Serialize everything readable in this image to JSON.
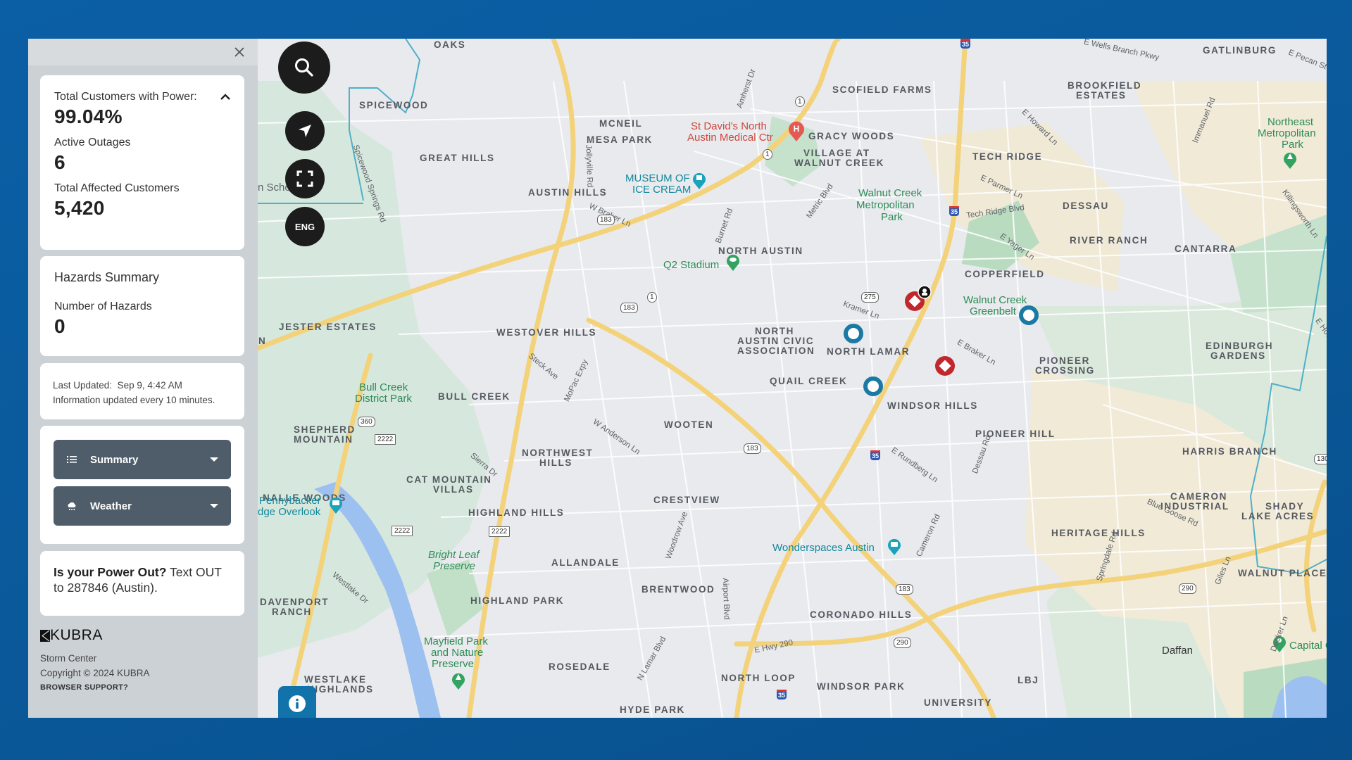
{
  "panel": {
    "close_label": "×",
    "stats": {
      "customers_with_power_label": "Total Customers with Power:",
      "customers_with_power_value": "99.04%",
      "active_outages_label": "Active Outages",
      "active_outages_value": "6",
      "affected_customers_label": "Total Affected Customers",
      "affected_customers_value": "5,420"
    },
    "hazards": {
      "title": "Hazards Summary",
      "count_label": "Number of Hazards",
      "count_value": "0"
    },
    "update": {
      "last_updated": "Last Updated:  Sep 9, 4:42 AM",
      "frequency": "Information updated every 10 minutes."
    },
    "accordions": [
      {
        "label": "Summary",
        "icon": "list-icon"
      },
      {
        "label": "Weather",
        "icon": "weather-icon"
      }
    ],
    "power_out": {
      "question": "Is your Power Out?",
      "instruction": " Text OUT to 287846 (Austin)."
    },
    "footer": {
      "logo": "KUBRA",
      "product": "Storm Center",
      "copyright": "Copyright © 2024 KUBRA",
      "browser_support": "BROWSER SUPPORT?"
    }
  },
  "map_controls": {
    "search_icon": "search-icon",
    "locate_icon": "navigation-arrow-icon",
    "fullscreen_icon": "fullscreen-icon",
    "language_label": "ENG",
    "info_icon": "info-icon"
  },
  "markers": {
    "outage_colors": {
      "crew_assigned": "#c0282d",
      "reported": "#1a7aa3"
    },
    "items": [
      {
        "type": "crew-outage",
        "badge": "crew-icon"
      },
      {
        "type": "crew-outage"
      },
      {
        "type": "outage"
      },
      {
        "type": "outage"
      },
      {
        "type": "outage"
      }
    ]
  },
  "map_labels": {
    "neighborhoods": [
      "OAKS",
      "SPICEWOOD",
      "GREAT HILLS",
      "AUSTIN HILLS",
      "MCNEIL",
      "MESA PARK",
      "SCOFIELD FARMS",
      "GRACY WOODS",
      "VILLAGE AT",
      "WALNUT CREEK",
      "TECH RIDGE",
      "GATLINBURG",
      "BROOKFIELD",
      "ESTATES",
      "DESSAU",
      "RIVER RANCH",
      "CANTARRA",
      "COPPERFIELD",
      "NORTH AUSTIN",
      "NORTH",
      "AUSTIN CIVIC",
      "ASSOCIATION",
      "NORTH LAMAR",
      "QUAIL CREEK",
      "WINDSOR HILLS",
      "PIONEER",
      "CROSSING",
      "EDINBURGH",
      "GARDENS",
      "PIONEER HILL",
      "HARRIS BRANCH",
      "SHADY",
      "LAKE ACRES",
      "JESTER ESTATES",
      "WESTOVER HILLS",
      "BULL CREEK",
      "SHEPHERD",
      "MOUNTAIN",
      "NORTHWEST",
      "HILLS",
      "WOOTEN",
      "CAT MOUNTAIN",
      "VILLAS",
      "NALLE WOODS",
      "HIGHLAND HILLS",
      "CRESTVIEW",
      "CAMERON",
      "INDUSTRIAL",
      "HERITAGE HILLS",
      "WALNUT PLACE",
      "ALLANDALE",
      "BRENTWOOD",
      "DAVENPORT",
      "RANCH",
      "HIGHLAND PARK",
      "CORONADO HILLS",
      "WESTLAKE",
      "HIGHLANDS",
      "ROSEDALE",
      "NORTH LOOP",
      "WINDSOR PARK",
      "LBJ",
      "UNIVERSITY",
      "HYDE PARK",
      "N"
    ],
    "parks": [
      "Walnut Creek",
      "Metropolitan",
      "Park",
      "Walnut Creek",
      "Greenbelt",
      "Northeast",
      "Metropolitan",
      "Park",
      "Bull Creek",
      "District Park",
      "Bright Leaf",
      "Preserve",
      "Mayfield Park",
      "and Nature",
      "Preserve",
      "Capital Cit"
    ],
    "pois": [
      "St David's North",
      "Austin Medical Ctr",
      "MUSEUM OF",
      "ICE CREAM",
      "Q2 Stadium",
      "Pennybacker",
      "dge Overlook",
      "Wonderspaces Austin",
      "n Scho"
    ],
    "streets": [
      "E Wells Branch Pkwy",
      "E Pecan St",
      "Immanuel Rd",
      "E Howard Ln",
      "Killingsworth Ln",
      "E Parmer Ln",
      "Tech Ridge Blvd",
      "E Yager Ln",
      "Metric Blvd",
      "Burnet Rd",
      "Amherst Dr",
      "W Braker Ln",
      "Jollyville Rd",
      "Spicewood Springs Rd",
      "Kramer Ln",
      "E Braker Ln",
      "Dessau Rd",
      "E Rundberg Ln",
      "Cameron Rd",
      "Springdale Rd",
      "Blue Goose Rd",
      "Giles Ln",
      "Decker Ln",
      "E Hwy 290",
      "MoPac Expy",
      "Steck Ave",
      "W Anderson Ln",
      "Sierra Dr",
      "Woodrow Ave",
      "Airport Blvd",
      "N Lamar Blvd",
      "Westlake Dr",
      "E Howard Ln"
    ],
    "towns": [
      "Daffan"
    ],
    "shields": [
      "35",
      "35",
      "35",
      "35",
      "1",
      "1",
      "1",
      "183",
      "183",
      "183",
      "183",
      "275",
      "290",
      "290",
      "360",
      "2222",
      "2222",
      "2222",
      "130"
    ]
  }
}
